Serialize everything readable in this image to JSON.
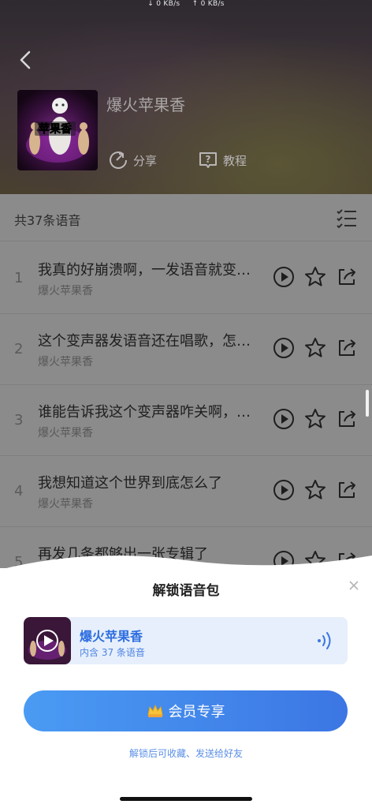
{
  "status_bar": {
    "down_speed": "↓ 0 KB/s",
    "up_speed": "↑ 0 KB/s"
  },
  "header": {
    "title": "爆火苹果香",
    "cover_text": "苹果香",
    "share_label": "分享",
    "tutorial_label": "教程"
  },
  "list": {
    "count_label": "共37条语音",
    "items": [
      {
        "index": "1",
        "title": "我真的好崩溃啊，一发语音就变成唱歌",
        "subtitle": "爆火苹果香"
      },
      {
        "index": "2",
        "title": "这个变声器发语音还在唱歌，怎么回事",
        "subtitle": "爆火苹果香"
      },
      {
        "index": "3",
        "title": "谁能告诉我这个变声器咋关啊，救命",
        "subtitle": "爆火苹果香"
      },
      {
        "index": "4",
        "title": "我想知道这个世界到底怎么了",
        "subtitle": "爆火苹果香"
      },
      {
        "index": "5",
        "title": "再发几条都够出一张专辑了",
        "subtitle": "爆火苹果香"
      }
    ]
  },
  "unlock_sheet": {
    "title": "解锁语音包",
    "pack_name": "爆火苹果香",
    "pack_count": "内含 37 条语音",
    "vip_button": "会员专享",
    "hint": "解锁后可收藏、发送给好友"
  },
  "colors": {
    "accent": "#3c76e4",
    "pack_bg": "#e6effb",
    "overlay": "#8b8b8b"
  }
}
